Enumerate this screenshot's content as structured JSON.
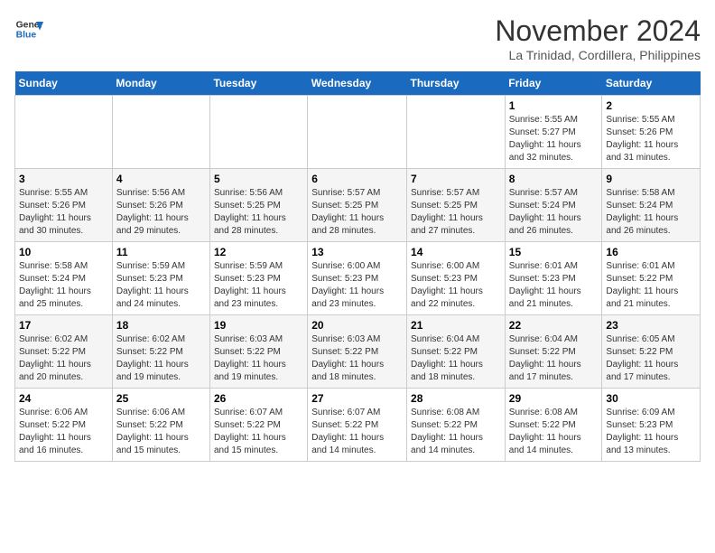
{
  "header": {
    "logo_line1": "General",
    "logo_line2": "Blue",
    "month": "November 2024",
    "location": "La Trinidad, Cordillera, Philippines"
  },
  "weekdays": [
    "Sunday",
    "Monday",
    "Tuesday",
    "Wednesday",
    "Thursday",
    "Friday",
    "Saturday"
  ],
  "weeks": [
    [
      {
        "day": "",
        "info": ""
      },
      {
        "day": "",
        "info": ""
      },
      {
        "day": "",
        "info": ""
      },
      {
        "day": "",
        "info": ""
      },
      {
        "day": "",
        "info": ""
      },
      {
        "day": "1",
        "info": "Sunrise: 5:55 AM\nSunset: 5:27 PM\nDaylight: 11 hours\nand 32 minutes."
      },
      {
        "day": "2",
        "info": "Sunrise: 5:55 AM\nSunset: 5:26 PM\nDaylight: 11 hours\nand 31 minutes."
      }
    ],
    [
      {
        "day": "3",
        "info": "Sunrise: 5:55 AM\nSunset: 5:26 PM\nDaylight: 11 hours\nand 30 minutes."
      },
      {
        "day": "4",
        "info": "Sunrise: 5:56 AM\nSunset: 5:26 PM\nDaylight: 11 hours\nand 29 minutes."
      },
      {
        "day": "5",
        "info": "Sunrise: 5:56 AM\nSunset: 5:25 PM\nDaylight: 11 hours\nand 28 minutes."
      },
      {
        "day": "6",
        "info": "Sunrise: 5:57 AM\nSunset: 5:25 PM\nDaylight: 11 hours\nand 28 minutes."
      },
      {
        "day": "7",
        "info": "Sunrise: 5:57 AM\nSunset: 5:25 PM\nDaylight: 11 hours\nand 27 minutes."
      },
      {
        "day": "8",
        "info": "Sunrise: 5:57 AM\nSunset: 5:24 PM\nDaylight: 11 hours\nand 26 minutes."
      },
      {
        "day": "9",
        "info": "Sunrise: 5:58 AM\nSunset: 5:24 PM\nDaylight: 11 hours\nand 26 minutes."
      }
    ],
    [
      {
        "day": "10",
        "info": "Sunrise: 5:58 AM\nSunset: 5:24 PM\nDaylight: 11 hours\nand 25 minutes."
      },
      {
        "day": "11",
        "info": "Sunrise: 5:59 AM\nSunset: 5:23 PM\nDaylight: 11 hours\nand 24 minutes."
      },
      {
        "day": "12",
        "info": "Sunrise: 5:59 AM\nSunset: 5:23 PM\nDaylight: 11 hours\nand 23 minutes."
      },
      {
        "day": "13",
        "info": "Sunrise: 6:00 AM\nSunset: 5:23 PM\nDaylight: 11 hours\nand 23 minutes."
      },
      {
        "day": "14",
        "info": "Sunrise: 6:00 AM\nSunset: 5:23 PM\nDaylight: 11 hours\nand 22 minutes."
      },
      {
        "day": "15",
        "info": "Sunrise: 6:01 AM\nSunset: 5:23 PM\nDaylight: 11 hours\nand 21 minutes."
      },
      {
        "day": "16",
        "info": "Sunrise: 6:01 AM\nSunset: 5:22 PM\nDaylight: 11 hours\nand 21 minutes."
      }
    ],
    [
      {
        "day": "17",
        "info": "Sunrise: 6:02 AM\nSunset: 5:22 PM\nDaylight: 11 hours\nand 20 minutes."
      },
      {
        "day": "18",
        "info": "Sunrise: 6:02 AM\nSunset: 5:22 PM\nDaylight: 11 hours\nand 19 minutes."
      },
      {
        "day": "19",
        "info": "Sunrise: 6:03 AM\nSunset: 5:22 PM\nDaylight: 11 hours\nand 19 minutes."
      },
      {
        "day": "20",
        "info": "Sunrise: 6:03 AM\nSunset: 5:22 PM\nDaylight: 11 hours\nand 18 minutes."
      },
      {
        "day": "21",
        "info": "Sunrise: 6:04 AM\nSunset: 5:22 PM\nDaylight: 11 hours\nand 18 minutes."
      },
      {
        "day": "22",
        "info": "Sunrise: 6:04 AM\nSunset: 5:22 PM\nDaylight: 11 hours\nand 17 minutes."
      },
      {
        "day": "23",
        "info": "Sunrise: 6:05 AM\nSunset: 5:22 PM\nDaylight: 11 hours\nand 17 minutes."
      }
    ],
    [
      {
        "day": "24",
        "info": "Sunrise: 6:06 AM\nSunset: 5:22 PM\nDaylight: 11 hours\nand 16 minutes."
      },
      {
        "day": "25",
        "info": "Sunrise: 6:06 AM\nSunset: 5:22 PM\nDaylight: 11 hours\nand 15 minutes."
      },
      {
        "day": "26",
        "info": "Sunrise: 6:07 AM\nSunset: 5:22 PM\nDaylight: 11 hours\nand 15 minutes."
      },
      {
        "day": "27",
        "info": "Sunrise: 6:07 AM\nSunset: 5:22 PM\nDaylight: 11 hours\nand 14 minutes."
      },
      {
        "day": "28",
        "info": "Sunrise: 6:08 AM\nSunset: 5:22 PM\nDaylight: 11 hours\nand 14 minutes."
      },
      {
        "day": "29",
        "info": "Sunrise: 6:08 AM\nSunset: 5:22 PM\nDaylight: 11 hours\nand 14 minutes."
      },
      {
        "day": "30",
        "info": "Sunrise: 6:09 AM\nSunset: 5:23 PM\nDaylight: 11 hours\nand 13 minutes."
      }
    ]
  ]
}
